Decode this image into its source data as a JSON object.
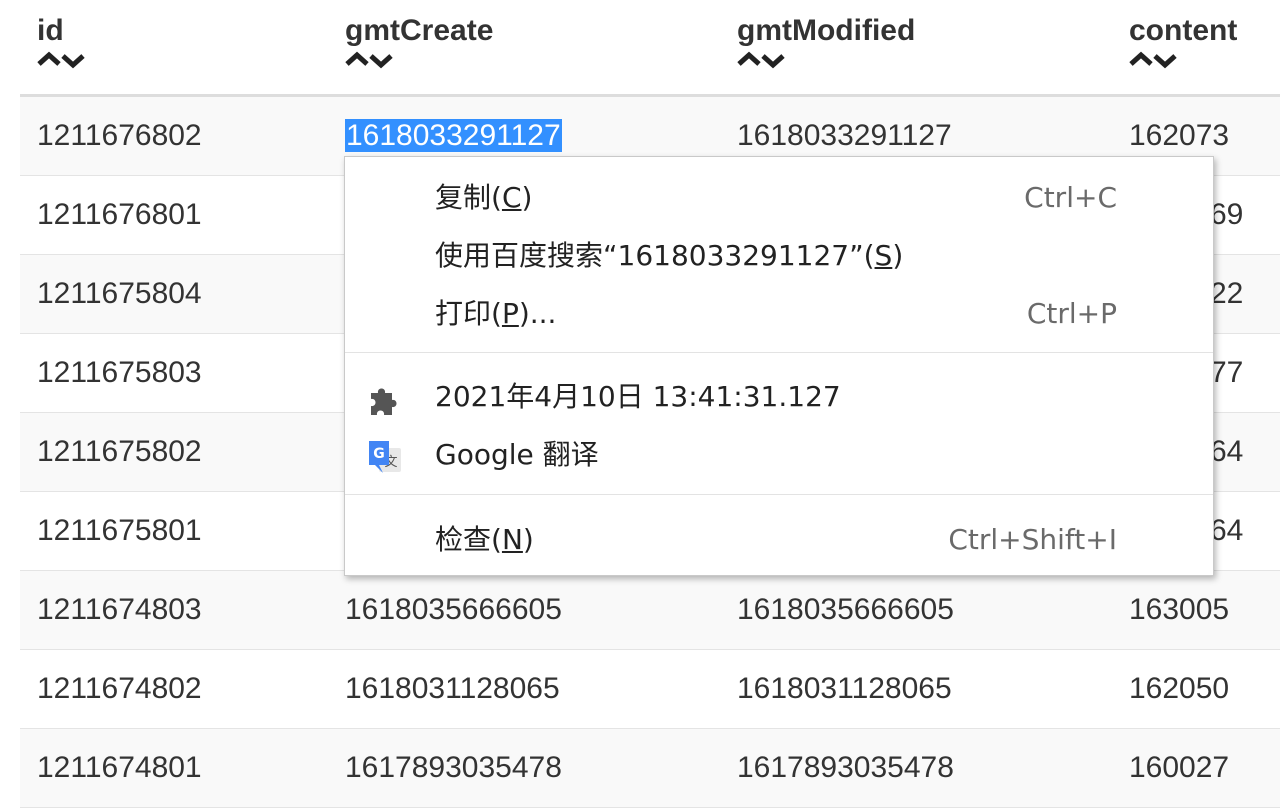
{
  "columns": [
    {
      "label": "id"
    },
    {
      "label": "gmtCreate"
    },
    {
      "label": "gmtModified"
    },
    {
      "label": "content"
    }
  ],
  "rows": [
    [
      "1211676802",
      "1618033291127",
      "1618033291127",
      "162073"
    ],
    [
      "1211676801",
      "",
      "",
      "69"
    ],
    [
      "1211675804",
      "",
      "",
      "22"
    ],
    [
      "1211675803",
      "",
      "",
      "77"
    ],
    [
      "1211675802",
      "",
      "",
      "64"
    ],
    [
      "1211675801",
      "",
      "",
      "64"
    ],
    [
      "1211674803",
      "1618035666605",
      "1618035666605",
      "163005"
    ],
    [
      "1211674802",
      "1618031128065",
      "1618031128065",
      "162050"
    ],
    [
      "1211674801",
      "1617893035478",
      "1617893035478",
      "160027"
    ]
  ],
  "selection": {
    "text": "1618033291127"
  },
  "context_menu": {
    "copy": {
      "label_pre": "复制(",
      "accel": "C",
      "label_post": ")",
      "shortcut": "Ctrl+C"
    },
    "search": {
      "label_pre": "使用百度搜索“1618033291127”(",
      "accel": "S",
      "label_post": ")"
    },
    "print": {
      "label_pre": "打印(",
      "accel": "P",
      "label_post": ")...",
      "shortcut": "Ctrl+P"
    },
    "timestamp_ext": {
      "label": "2021年4月10日 13:41:31.127",
      "icon": "puzzle-icon"
    },
    "google_translate": {
      "label": "Google 翻译",
      "icon": "google-translate-icon"
    },
    "inspect": {
      "label_pre": "检查(",
      "accel": "N",
      "label_post": ")",
      "shortcut": "Ctrl+Shift+I"
    }
  },
  "colors": {
    "selection_bg": "#3390ff",
    "stripe": "#f9f9f9",
    "menu_shortcut": "#6a6a6a"
  }
}
